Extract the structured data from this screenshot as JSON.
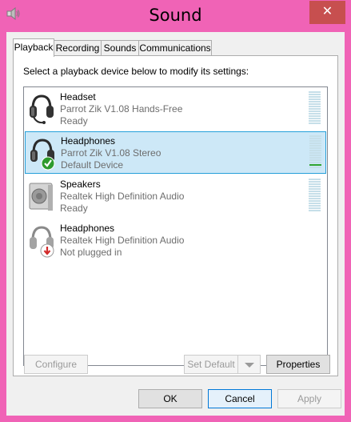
{
  "window": {
    "title": "Sound",
    "close_glyph": "✕"
  },
  "tabs": [
    {
      "label": "Playback"
    },
    {
      "label": "Recording"
    },
    {
      "label": "Sounds"
    },
    {
      "label": "Communications"
    }
  ],
  "instruction": "Select a playback device below to modify its settings:",
  "devices": [
    {
      "name": "Headset",
      "driver": "Parrot Zik V1.08 Hands-Free",
      "status": "Ready",
      "icon": "headset-icon",
      "level": 0
    },
    {
      "name": "Headphones",
      "driver": "Parrot Zik V1.08 Stereo",
      "status": "Default Device",
      "icon": "headphones-default-icon",
      "level": 0.1,
      "selected": true
    },
    {
      "name": "Speakers",
      "driver": "Realtek High Definition Audio",
      "status": "Ready",
      "icon": "speaker-icon",
      "level": 0
    },
    {
      "name": "Headphones",
      "driver": "Realtek High Definition Audio",
      "status": "Not plugged in",
      "icon": "headphones-unplugged-icon"
    }
  ],
  "buttons": {
    "configure": "Configure",
    "set_default": "Set Default",
    "properties": "Properties",
    "ok": "OK",
    "cancel": "Cancel",
    "apply": "Apply"
  },
  "colors": {
    "frame": "#f063b6",
    "close": "#c74f4f",
    "selection": "#cde8f7",
    "selection_border": "#26a0da",
    "meter_on": "#2fa32f",
    "meter_off": "#c6dfe9"
  }
}
